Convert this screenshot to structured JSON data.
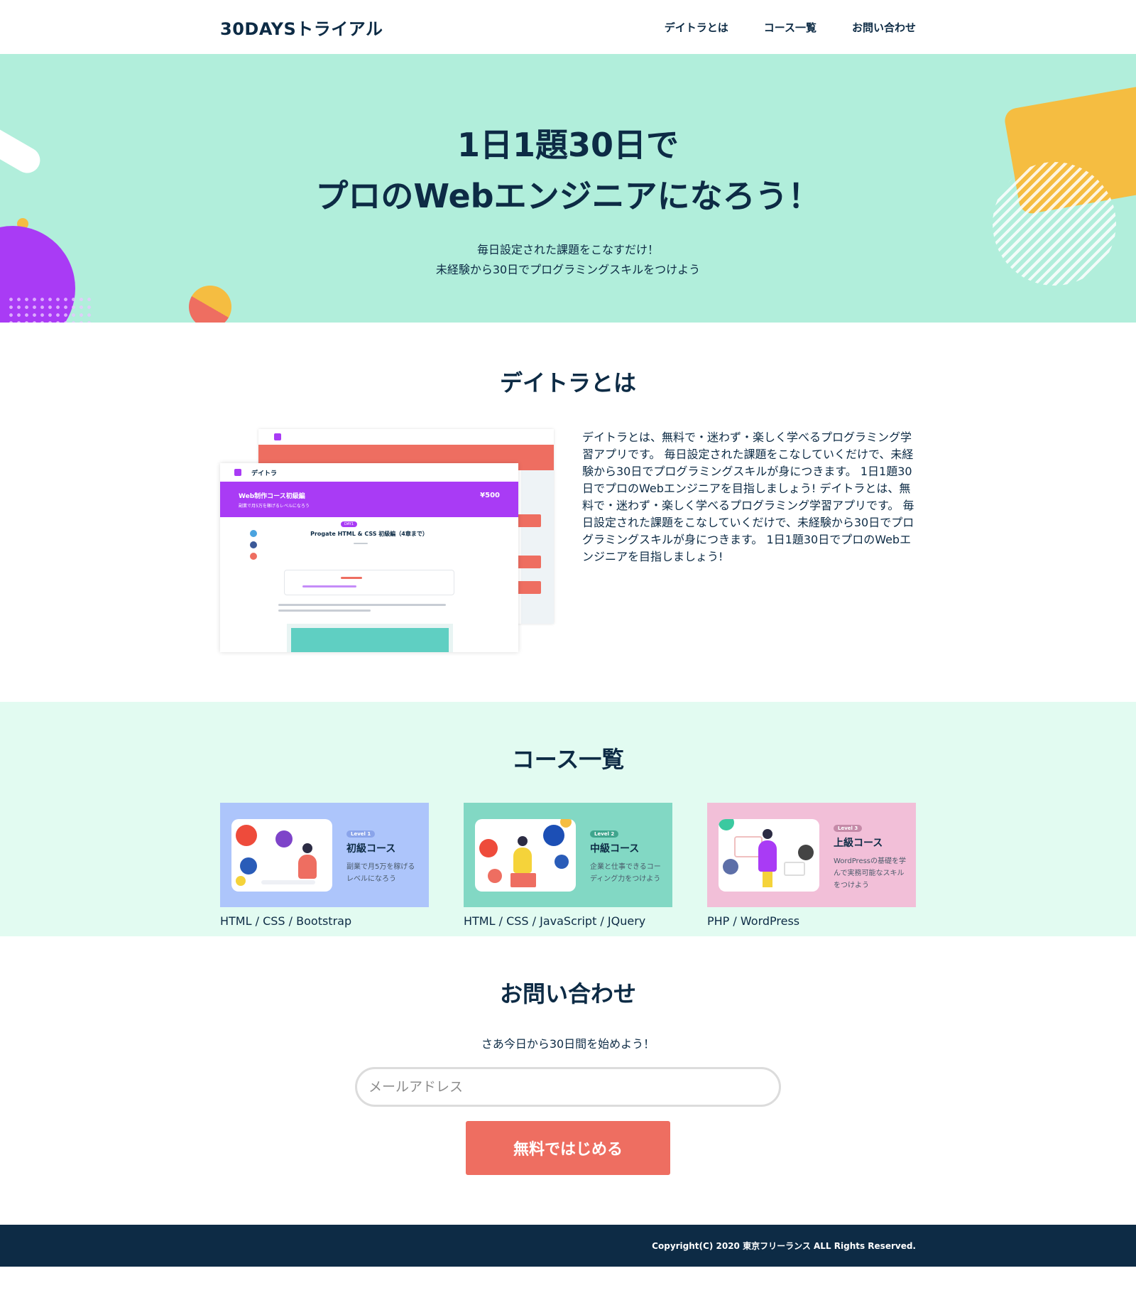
{
  "header": {
    "logo": "30DAYSトライアル",
    "nav": [
      "デイトラとは",
      "コース一覧",
      "お問い合わせ"
    ]
  },
  "hero": {
    "title_line1": "1日1題30日で",
    "title_line2": "プロのWebエンジニアになろう！",
    "sub_line1": "毎日設定された課題をこなすだけ！",
    "sub_line2": "未経験から30日でプログラミングスキルをつけよう"
  },
  "about": {
    "title": "デイトラとは",
    "text": "デイトラとは、無料で・迷わず・楽しく学べるプログラミング学習アプリです。 毎日設定された課題をこなしていくだけで、未経験から30日でプログラミングスキルが身につきます。 1日1題30日でプロのWebエンジニアを目指しましょう! デイトラとは、無料で・迷わず・楽しく学べるプログラミング学習アプリです。 毎日設定された課題をこなしていくだけで、未経験から30日でプログラミングスキルが身につきます。 1日1題30日でプロのWebエンジニアを目指しましょう!",
    "mock": {
      "brand": "デイトラ",
      "band_title": "Web制作コース初級編",
      "band_sub": "副業で月5万を稼げるレベルになろう",
      "price": "¥500",
      "day_badge": "DAY1",
      "lesson_title": "Progate HTML & CSS 初級編（4章まで）"
    }
  },
  "courses": {
    "title": "コース一覧",
    "items": [
      {
        "level": "Level 1",
        "name": "初級コース",
        "desc": "副業で月5万を稼げるレベルになろう",
        "tags": "HTML / CSS / Bootstrap"
      },
      {
        "level": "Level 2",
        "name": "中級コース",
        "desc": "企業と仕事できるコーディング力をつけよう",
        "tags": "HTML / CSS / JavaScript / JQuery"
      },
      {
        "level": "Level 3",
        "name": "上級コース",
        "desc": "WordPressの基礎を学んで実務可能なスキルをつけよう",
        "tags": "PHP / WordPress"
      }
    ]
  },
  "contact": {
    "title": "お問い合わせ",
    "lead": "さあ今日から30日間を始めよう！",
    "email_placeholder": "メールアドレス",
    "button": "無料ではじめる"
  },
  "footer": {
    "copyright": "Copyright(C) 2020 東京フリーランス ALL Rights Reserved."
  },
  "colors": {
    "navy": "#0d2b45",
    "mint": "#b1eedb",
    "light_mint": "#e2fbf1",
    "coral": "#ee6e61",
    "purple": "#a93bf5",
    "yellow": "#f5bd41"
  }
}
